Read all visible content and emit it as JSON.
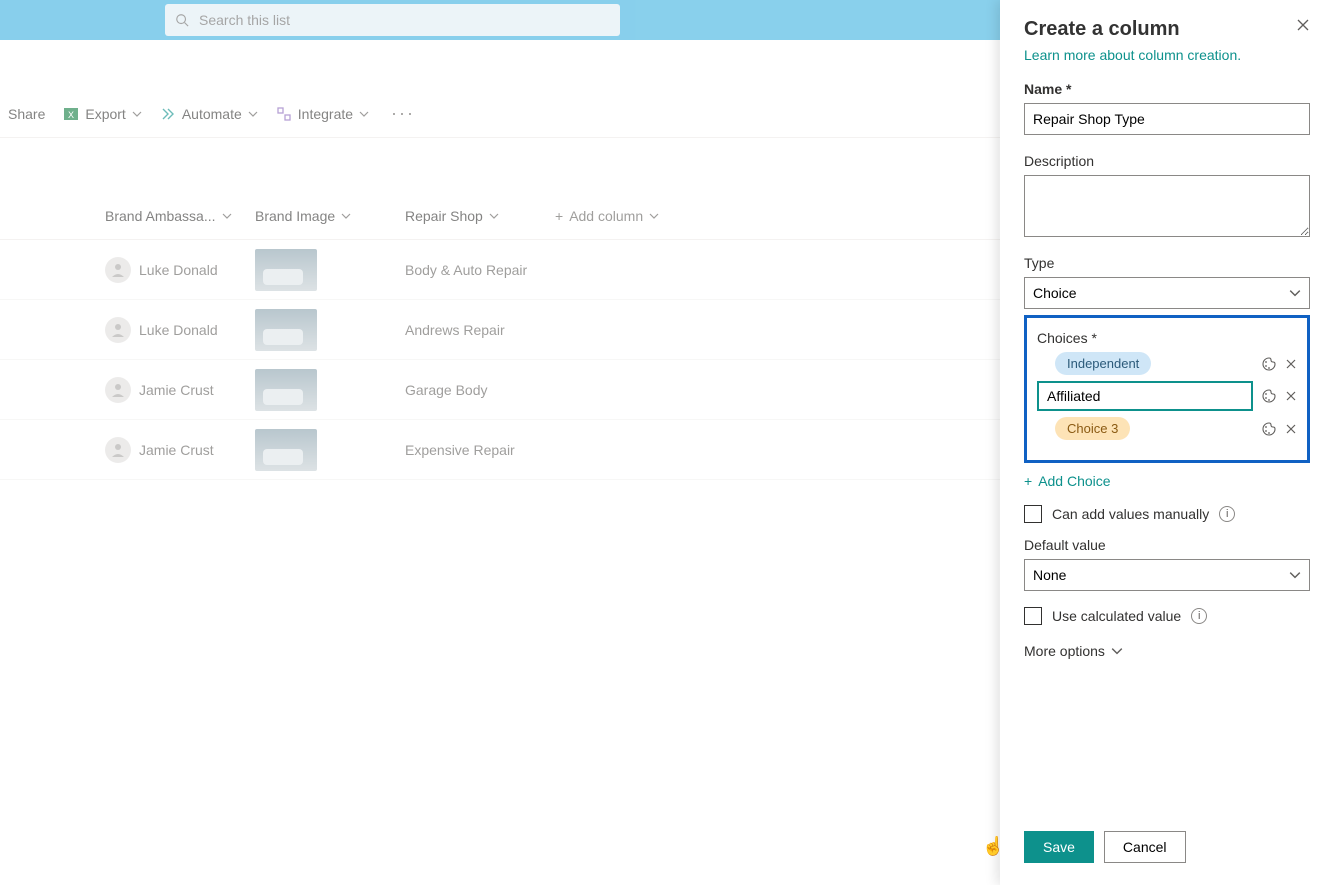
{
  "search": {
    "placeholder": "Search this list"
  },
  "commands": {
    "share": "Share",
    "export": "Export",
    "automate": "Automate",
    "integrate": "Integrate"
  },
  "columns": {
    "brand_amb": "Brand Ambassa...",
    "brand_img": "Brand Image",
    "repair_shop": "Repair Shop",
    "add_column": "Add column"
  },
  "rows": [
    {
      "name": "Luke Donald",
      "shop": "Body & Auto Repair"
    },
    {
      "name": "Luke Donald",
      "shop": "Andrews Repair"
    },
    {
      "name": "Jamie Crust",
      "shop": "Garage Body"
    },
    {
      "name": "Jamie Crust",
      "shop": "Expensive Repair"
    }
  ],
  "panel": {
    "title": "Create a column",
    "learn": "Learn more about column creation.",
    "name_label": "Name",
    "name_value": "Repair Shop Type",
    "desc_label": "Description",
    "type_label": "Type",
    "type_value": "Choice",
    "choices_label": "Choices",
    "choice1": "Independent",
    "choice2_value": "Affiliated",
    "choice3": "Choice 3",
    "add_choice": "Add Choice",
    "manual_cb": "Can add values manually",
    "default_label": "Default value",
    "default_value": "None",
    "calc_cb": "Use calculated value",
    "more_opts": "More options",
    "save": "Save",
    "cancel": "Cancel"
  }
}
